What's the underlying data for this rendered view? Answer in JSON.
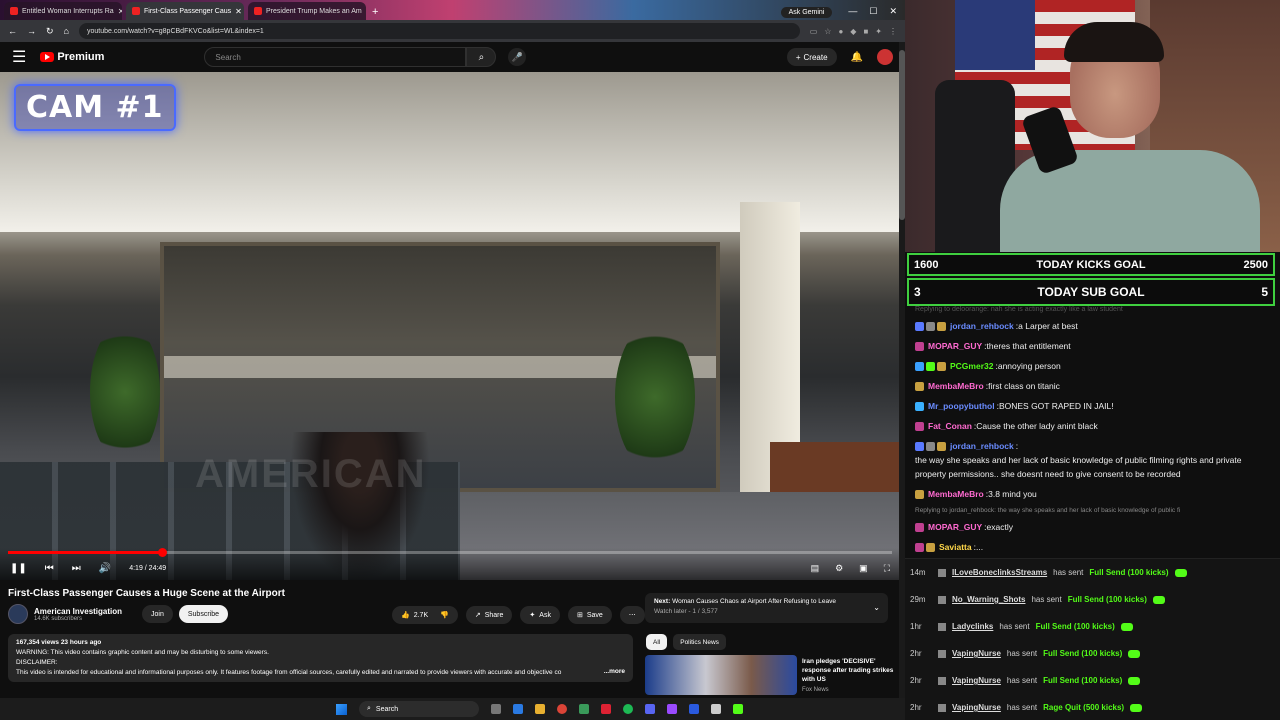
{
  "browser": {
    "tabs": [
      {
        "title": "Entitled Woman Interrupts Ra",
        "active": false
      },
      {
        "title": "First-Class Passenger Caus",
        "active": true
      },
      {
        "title": "President Trump Makes an Am",
        "active": false
      }
    ],
    "new_tab": "+",
    "ask_gemini": "Ask Gemini",
    "url": "youtube.com/watch?v=g8pCBdFKVCo&list=WL&index=1"
  },
  "youtube": {
    "brand": "Premium",
    "search_placeholder": "Search",
    "create_label": "Create"
  },
  "video": {
    "overlay": "CAM #1",
    "watermark": "AMERICAN",
    "current_time": "4:19 / 24:49",
    "progress": 0.174
  },
  "details": {
    "title": "First-Class Passenger Causes a Huge Scene at the Airport",
    "channel": "American Investigation",
    "subscribers": "14.6K subscribers",
    "join_label": "Join",
    "subscribe_label": "Subscribe",
    "likes": "2.7K",
    "share_label": "Share",
    "ask_label": "Ask",
    "save_label": "Save",
    "desc_line1": "167,354 views  23 hours ago",
    "desc_line2": "WARNING: This video contains graphic content and may be disturbing to some viewers.",
    "desc_line3": "DISCLAIMER:",
    "desc_line4": "This video is intended for educational and informational purposes only. It features footage from official sources, carefully edited and narrated to provide viewers with accurate and objective co",
    "more_label": "...more"
  },
  "sidebar": {
    "next_prefix": "Next:",
    "next_title": "Woman Causes Chaos at Airport After Refusing to Leave",
    "next_sub": "Watch later - 1 / 3,577",
    "chips": [
      "All",
      "Politics News"
    ],
    "rec_title": "Iran pledges 'DECISIVE' response after trading strikes with US",
    "rec_channel": "Fox News"
  },
  "taskbar": {
    "search_label": "Search"
  },
  "stream": {
    "kicks_goal": {
      "current": "1600",
      "label": "TODAY KICKS GOAL",
      "target": "2500"
    },
    "sub_goal": {
      "current": "3",
      "label": "TODAY SUB GOAL",
      "target": "5"
    },
    "faded_line": "Replying to deloorange: nah she is acting exactly like a law student",
    "messages": [
      {
        "user": "jordan_rehbock",
        "text": "a Larper at best",
        "color": "#6a8cff",
        "badges": [
          "#5a7aff",
          "#888",
          "#c8a040"
        ]
      },
      {
        "user": "MOPAR_GUY",
        "text": "theres that entitlement",
        "color": "#ff6ad0",
        "badges": [
          "#c04090"
        ]
      },
      {
        "user": "PCGmer32",
        "text": "annoying person",
        "color": "#53fc18",
        "badges": [
          "#3aa0ff",
          "#53fc18",
          "#c8a040"
        ]
      },
      {
        "user": "MembaMeBro",
        "text": "first class on titanic",
        "color": "#ff6ad0",
        "badges": [
          "#c8a040"
        ]
      },
      {
        "user": "Mr_poopybuthol",
        "text": "BONES GOT RAPED IN JAIL!",
        "color": "#6a8cff",
        "badges": [
          "#3ab0ff"
        ]
      },
      {
        "user": "Fat_Conan",
        "text": "Cause the other lady anint black",
        "color": "#ff6ad0",
        "badges": [
          "#c04090"
        ]
      },
      {
        "user": "jordan_rehbock",
        "text": "the way she speaks and her lack of basic knowledge of public filming rights and private property permissions.. she doesnt need to give consent to be recorded",
        "color": "#6a8cff",
        "badges": [
          "#5a7aff",
          "#888",
          "#c8a040"
        ]
      },
      {
        "user": "MembaMeBro",
        "text": "3.8 mind you",
        "color": "#ff6ad0",
        "badges": [
          "#c8a040"
        ]
      }
    ],
    "reply_line": "Replying to jordan_rehbock: the way she speaks and her lack of basic knowledge of public fi",
    "tail_messages": [
      {
        "user": "MOPAR_GUY",
        "text": "exactly",
        "color": "#ff6ad0",
        "badges": [
          "#c04090"
        ]
      },
      {
        "user": "Saviatta",
        "text": "...",
        "color": "#ffd84a",
        "badges": [
          "#c04090",
          "#c8a040"
        ]
      }
    ],
    "events": [
      {
        "time": "14m",
        "user": "ILoveBoneclinksStreams",
        "action": "has sent",
        "item": "Full Send (100 kicks)"
      },
      {
        "time": "29m",
        "user": "No_Warning_Shots",
        "action": "has sent",
        "item": "Full Send (100 kicks)"
      },
      {
        "time": "1hr",
        "user": "Ladyclinks",
        "action": "has sent",
        "item": "Full Send (100 kicks)"
      },
      {
        "time": "2hr",
        "user": "VapingNurse",
        "action": "has sent",
        "item": "Full Send (100 kicks)"
      },
      {
        "time": "2hr",
        "user": "VapingNurse",
        "action": "has sent",
        "item": "Full Send (100 kicks)"
      },
      {
        "time": "2hr",
        "user": "VapingNurse",
        "action": "has sent",
        "item": "Rage Quit (500 kicks)"
      }
    ]
  }
}
